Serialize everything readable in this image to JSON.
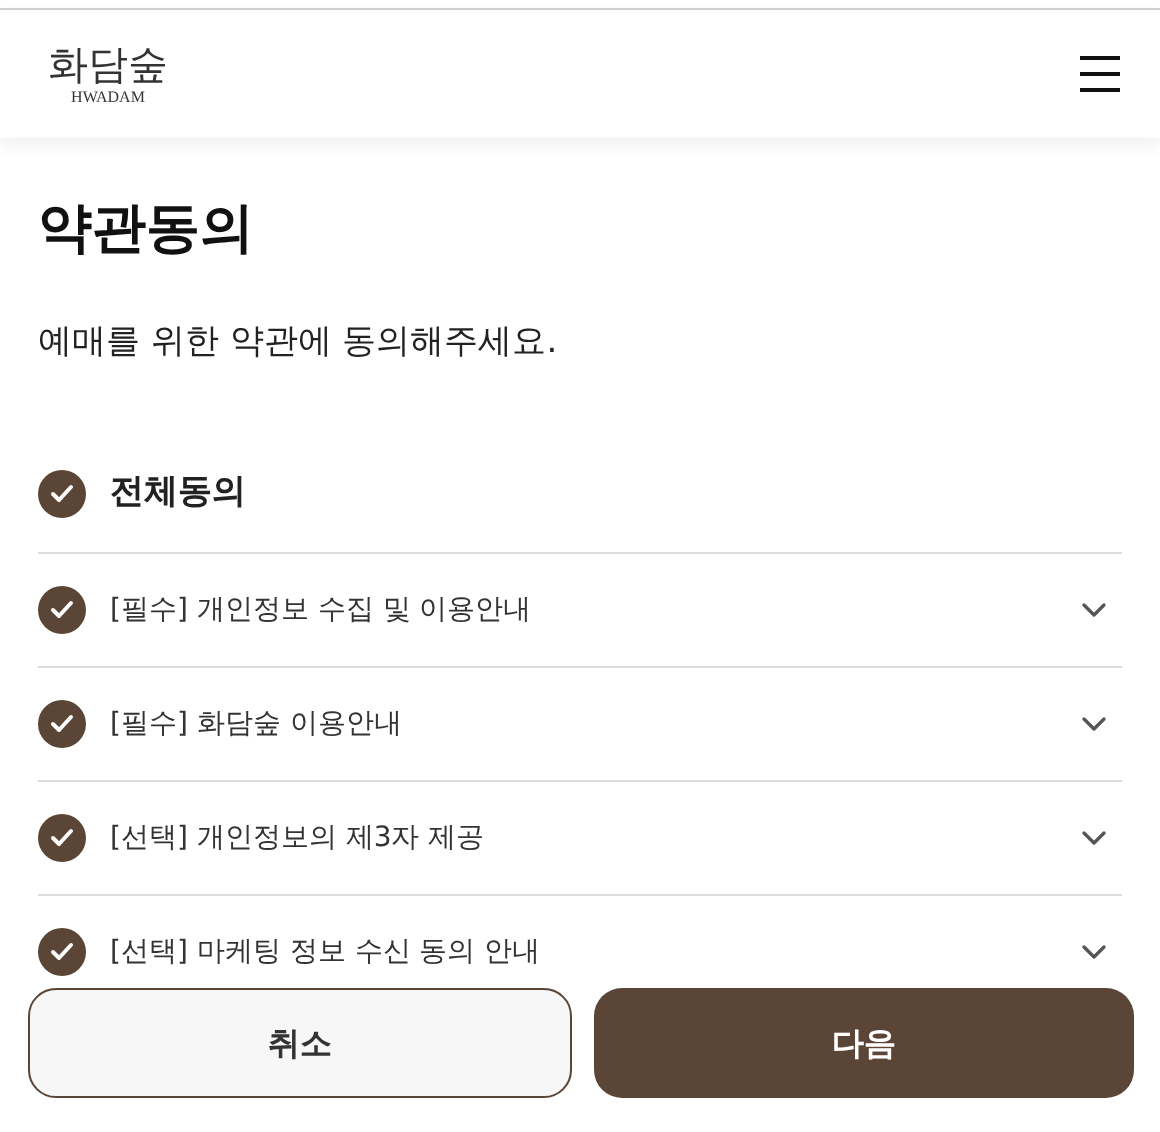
{
  "header": {
    "logo": "화담숲",
    "logo_sub": "HWADAM"
  },
  "title": "약관동의",
  "subtitle": "예매를 위한 약관에 동의해주세요.",
  "agree_all": {
    "label": "전체동의",
    "checked": true
  },
  "terms": [
    {
      "label": "[필수] 개인정보 수집 및 이용안내",
      "checked": true
    },
    {
      "label": "[필수] 화담숲 이용안내",
      "checked": true
    },
    {
      "label": "[선택] 개인정보의 제3자 제공",
      "checked": true
    },
    {
      "label": "[선택] 마케팅 정보 수신 동의 안내",
      "checked": true
    }
  ],
  "buttons": [
    {
      "label": "취소",
      "kind": "secondary"
    },
    {
      "label": "다음",
      "kind": "primary"
    }
  ]
}
